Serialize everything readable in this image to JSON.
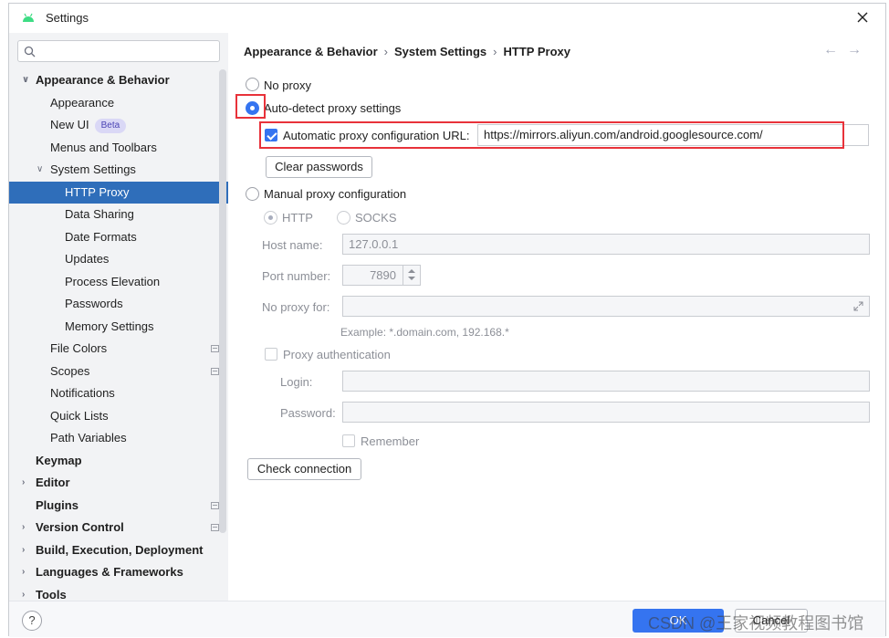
{
  "window": {
    "title": "Settings"
  },
  "search": {
    "placeholder": ""
  },
  "sidebar": {
    "items": [
      {
        "label": "Appearance & Behavior",
        "arrow": "v",
        "bold": true
      },
      {
        "label": "Appearance"
      },
      {
        "label": "New UI",
        "badge": "Beta"
      },
      {
        "label": "Menus and Toolbars"
      },
      {
        "label": "System Settings",
        "arrow": "v"
      },
      {
        "label": "HTTP Proxy",
        "selected": true
      },
      {
        "label": "Data Sharing"
      },
      {
        "label": "Date Formats"
      },
      {
        "label": "Updates"
      },
      {
        "label": "Process Elevation"
      },
      {
        "label": "Passwords"
      },
      {
        "label": "Memory Settings"
      },
      {
        "label": "File Colors"
      },
      {
        "label": "Scopes"
      },
      {
        "label": "Notifications"
      },
      {
        "label": "Quick Lists"
      },
      {
        "label": "Path Variables"
      },
      {
        "label": "Keymap",
        "bold": true
      },
      {
        "label": "Editor",
        "arrow": ">",
        "bold": true
      },
      {
        "label": "Plugins",
        "bold": true
      },
      {
        "label": "Version Control",
        "arrow": ">",
        "bold": true
      },
      {
        "label": "Build, Execution, Deployment",
        "arrow": ">",
        "bold": true
      },
      {
        "label": "Languages & Frameworks",
        "arrow": ">",
        "bold": true
      },
      {
        "label": "Tools",
        "arrow": ">",
        "bold": true
      }
    ]
  },
  "breadcrumb": [
    "Appearance & Behavior",
    "System Settings",
    "HTTP Proxy"
  ],
  "proxy": {
    "no_proxy_label": "No proxy",
    "auto_detect_label": "Auto-detect proxy settings",
    "auto_config_url_label": "Automatic proxy configuration URL:",
    "auto_config_url_value": "https://mirrors.aliyun.com/android.googlesource.com/",
    "clear_passwords_label": "Clear passwords",
    "manual_label": "Manual proxy configuration",
    "http_label": "HTTP",
    "socks_label": "SOCKS",
    "host_name_label": "Host name:",
    "host_name_value": "127.0.0.1",
    "port_number_label": "Port number:",
    "port_number_value": "7890",
    "no_proxy_for_label": "No proxy for:",
    "example_text": "Example: *.domain.com, 192.168.*",
    "proxy_auth_label": "Proxy authentication",
    "login_label": "Login:",
    "password_label": "Password:",
    "remember_label": "Remember",
    "check_connection_label": "Check connection"
  },
  "footer": {
    "help": "?",
    "ok_label": "OK",
    "cancel_label": "Cancel",
    "watermark": "CSDN @王家视频教程图书馆"
  },
  "colors": {
    "accent": "#3574f0",
    "selection": "#2f6eba",
    "highlight": "#e8323a"
  }
}
